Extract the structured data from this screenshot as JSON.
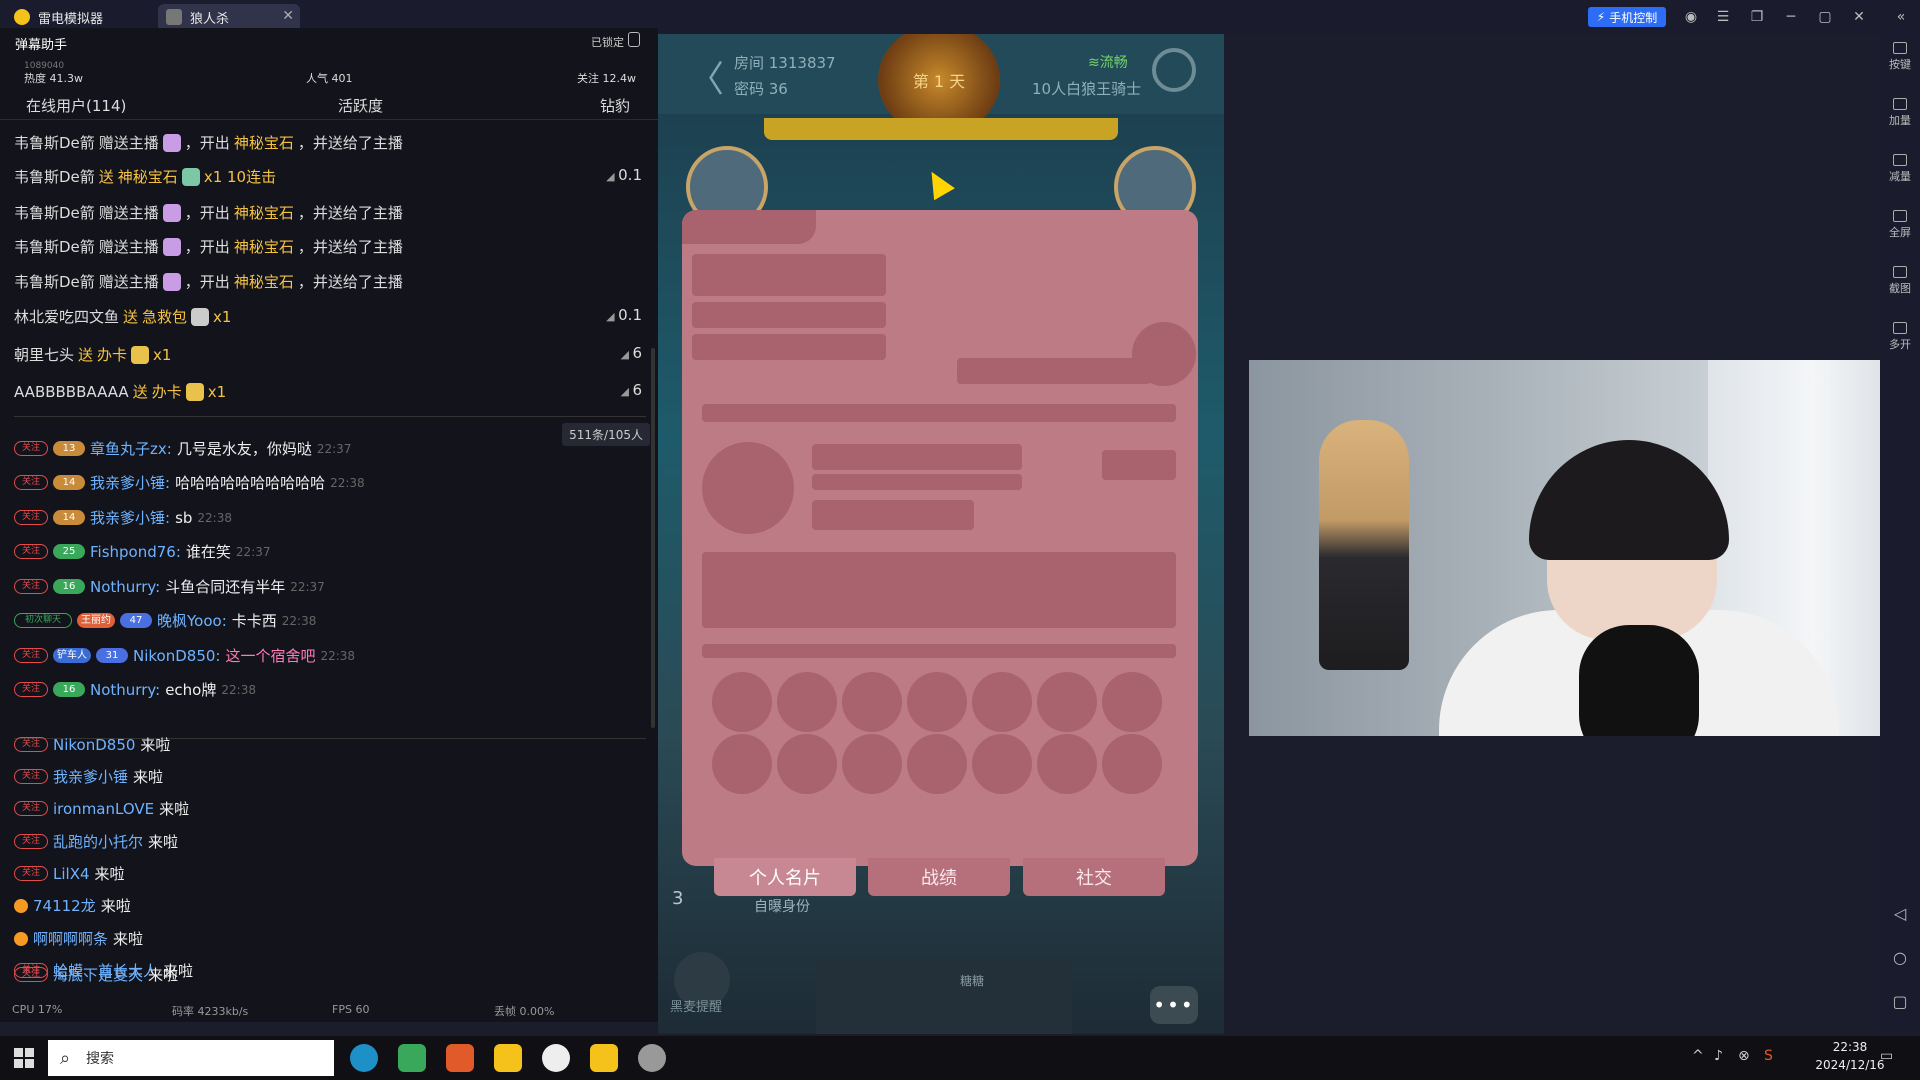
{
  "titlebar": {
    "app_name": "雷电模拟器",
    "game_tab": "狼人杀",
    "phone_control": "手机控制"
  },
  "danmu": {
    "title": "弹幕助手",
    "locked": "已锁定",
    "uid": "1089040",
    "heat": "热度 41.3w",
    "popularity": "人气 401",
    "follow": "关注 12.4w",
    "tabs": [
      "在线用户(114)",
      "活跃度",
      "钻豹"
    ],
    "gifts": [
      {
        "user": "韦鲁斯De箭",
        "action": " 赠送主播 ",
        "tail": "，开出",
        "gift": "神秘宝石",
        "tail2": "，并送给了主播",
        "amount": ""
      },
      {
        "user": "韦鲁斯De箭",
        "action": " 送 ",
        "gift": "神秘宝石",
        "qty": "x1 10连击",
        "amount": "0.1"
      },
      {
        "user": "韦鲁斯De箭",
        "action": " 赠送主播 ",
        "tail": "，开出",
        "gift": "神秘宝石",
        "tail2": "，并送给了主播",
        "amount": ""
      },
      {
        "user": "韦鲁斯De箭",
        "action": " 赠送主播 ",
        "tail": "，开出",
        "gift": "神秘宝石",
        "tail2": "，并送给了主播",
        "amount": ""
      },
      {
        "user": "韦鲁斯De箭",
        "action": " 赠送主播 ",
        "tail": "，开出",
        "gift": "神秘宝石",
        "tail2": "，并送给了主播",
        "amount": ""
      },
      {
        "user": "林北爱吃四文鱼",
        "action": " 送 ",
        "gift": "急救包",
        "qty": "x1",
        "amount": "0.1"
      },
      {
        "user": "朝里七头",
        "action": " 送 ",
        "gift": "办卡",
        "qty": "x1",
        "amount": "6"
      },
      {
        "user": "AABBBBBAAAA",
        "action": " 送 ",
        "gift": "办卡",
        "qty": "x1",
        "amount": "6"
      }
    ],
    "count_badge": "511条/105人",
    "chats": [
      {
        "tag": "关注",
        "lv": "13",
        "lv_color": "#c98a3a",
        "user": "章鱼丸子zx:",
        "text": "几号是水友，你妈哒",
        "time": "22:37"
      },
      {
        "tag": "关注",
        "lv": "14",
        "lv_color": "#c98a3a",
        "user": "我亲爹小锤:",
        "text": "哈哈哈哈哈哈哈哈哈哈",
        "time": "22:38"
      },
      {
        "tag": "关注",
        "lv": "14",
        "lv_color": "#c98a3a",
        "user": "我亲爹小锤:",
        "text": "sb",
        "time": "22:38"
      },
      {
        "tag": "关注",
        "lv": "25",
        "lv_color": "#3aa85a",
        "user": "Fishpond76:",
        "text": "谁在笑",
        "time": "22:37"
      },
      {
        "tag": "关注",
        "lv": "16",
        "lv_color": "#3aa85a",
        "user": "Nothurry:",
        "text": "斗鱼合同还有半年",
        "time": "22:37"
      },
      {
        "tag": "初次聊天",
        "lv": "47",
        "lv_color": "#4a6fe0",
        "badge": "王丽约",
        "user": "晚枫Yooo:",
        "text": "卡卡西",
        "time": "22:38"
      },
      {
        "tag": "关注",
        "lv": "31",
        "lv_color": "#4a6fe0",
        "badge": "铲车人",
        "user": "NikonD850:",
        "text": "这一个宿舍吧",
        "time": "22:38"
      },
      {
        "tag": "关注",
        "lv": "16",
        "lv_color": "#3aa85a",
        "user": "Nothurry:",
        "text": "echo牌",
        "time": "22:38"
      }
    ],
    "arrivals": [
      {
        "user": "NikonD850",
        "text": "来啦",
        "dot": false
      },
      {
        "user": "我亲爹小锤",
        "text": "来啦",
        "dot": false
      },
      {
        "user": "ironmanLOVE",
        "text": "来啦",
        "dot": false
      },
      {
        "user": "乱跑的小托尔",
        "text": "来啦",
        "dot": false
      },
      {
        "user": "LilX4",
        "text": "来啦",
        "dot": false
      },
      {
        "user": "74112龙",
        "text": "来啦",
        "dot": true
      },
      {
        "user": "啊啊啊啊条",
        "text": "来啦",
        "dot": true
      },
      {
        "user": "蛤蟆、酋长大人",
        "text": "来啦",
        "dot": false
      },
      {
        "user": "海底下是夏天",
        "text": "来啦",
        "dot": false
      }
    ],
    "status": {
      "cpu": "CPU 17%",
      "bitrate": "码率 4233kb/s",
      "fps": "FPS 60",
      "drop": "丢帧 0.00%"
    }
  },
  "game": {
    "room": "房间 1313837",
    "password": "密码 36",
    "day": "第 1 天",
    "net": "流畅",
    "mode": "10人白狼王骑士",
    "card_tabs": [
      "个人名片",
      "战绩",
      "社交"
    ],
    "self_id": "自曝身份",
    "round": "3",
    "mic_label": "黑麦提醒",
    "sugar": "糖糖"
  },
  "rightbar": [
    "按键",
    "加量",
    "减量",
    "全屏",
    "截图",
    "多开"
  ],
  "taskbar": {
    "search": "搜索",
    "time": "22:38",
    "date": "2024/12/16"
  }
}
